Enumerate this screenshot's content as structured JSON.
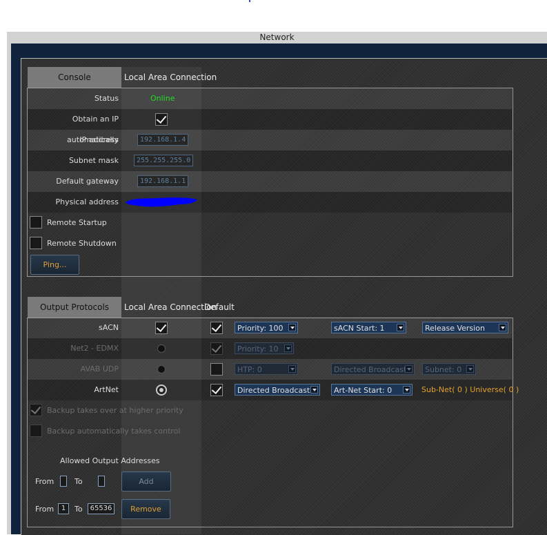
{
  "window": {
    "title": "Network"
  },
  "console_panel": {
    "tab_label": "Console",
    "column_header": "Local Area Connection",
    "rows": [
      {
        "label": "Status",
        "value": "Online",
        "value_color": "#22dd22"
      },
      {
        "label": "Obtain an IP automatically",
        "checked": true
      },
      {
        "label": "IP address",
        "value": "192.168.1.4"
      },
      {
        "label": "Subnet mask",
        "value": "255.255.255.0"
      },
      {
        "label": "Default gateway",
        "value": "192.168.1.1"
      },
      {
        "label": "Physical address",
        "value": "",
        "redacted": true,
        "redaction_color": "#0000ff"
      }
    ],
    "remote_startup": {
      "label": "Remote Startup",
      "checked": false
    },
    "remote_shutdown": {
      "label": "Remote Shutdown",
      "checked": false
    },
    "ping_button": "Ping..."
  },
  "output_panel": {
    "tab_label": "Output Protocols",
    "column_header": "Local Area Connection",
    "default_header": "Default",
    "protocols": [
      {
        "name": "sACN",
        "enabled": true,
        "lan": "checkbox-checked",
        "default_checked": true,
        "priority": "Priority: 100",
        "start": "sACN Start: 1",
        "version": "Release Version"
      },
      {
        "name": "Net2 - EDMX",
        "enabled": false,
        "lan": "radio-off",
        "default_checked": true,
        "priority": "Priority: 10"
      },
      {
        "name": "AVAB UDP",
        "enabled": false,
        "lan": "radio-off",
        "default_checked": false,
        "htp": "HTP: 0",
        "mode": "Directed Broadcast",
        "subnet": "Subnet: 0"
      },
      {
        "name": "ArtNet",
        "enabled": true,
        "lan": "radio-on",
        "default_checked": true,
        "mode": "Directed Broadcast",
        "start": "Art-Net Start: 0",
        "info": "Sub-Net( 0 ) Universe( 0 )"
      }
    ],
    "backup_higher_priority": {
      "label": "Backup takes over at higher priority",
      "checked": true
    },
    "backup_auto": {
      "label": "Backup automatically takes control",
      "checked": false
    },
    "allowed": {
      "title": "Allowed Output Addresses",
      "from_label": "From",
      "to_label": "To",
      "new_from": "",
      "new_to": "",
      "add_button": "Add",
      "range_from": "1",
      "range_to": "65536",
      "remove_button": "Remove"
    }
  },
  "colors": {
    "accent_orange": "#e2a22c",
    "status_green": "#22dd22",
    "frame_blue": "#10233c"
  }
}
